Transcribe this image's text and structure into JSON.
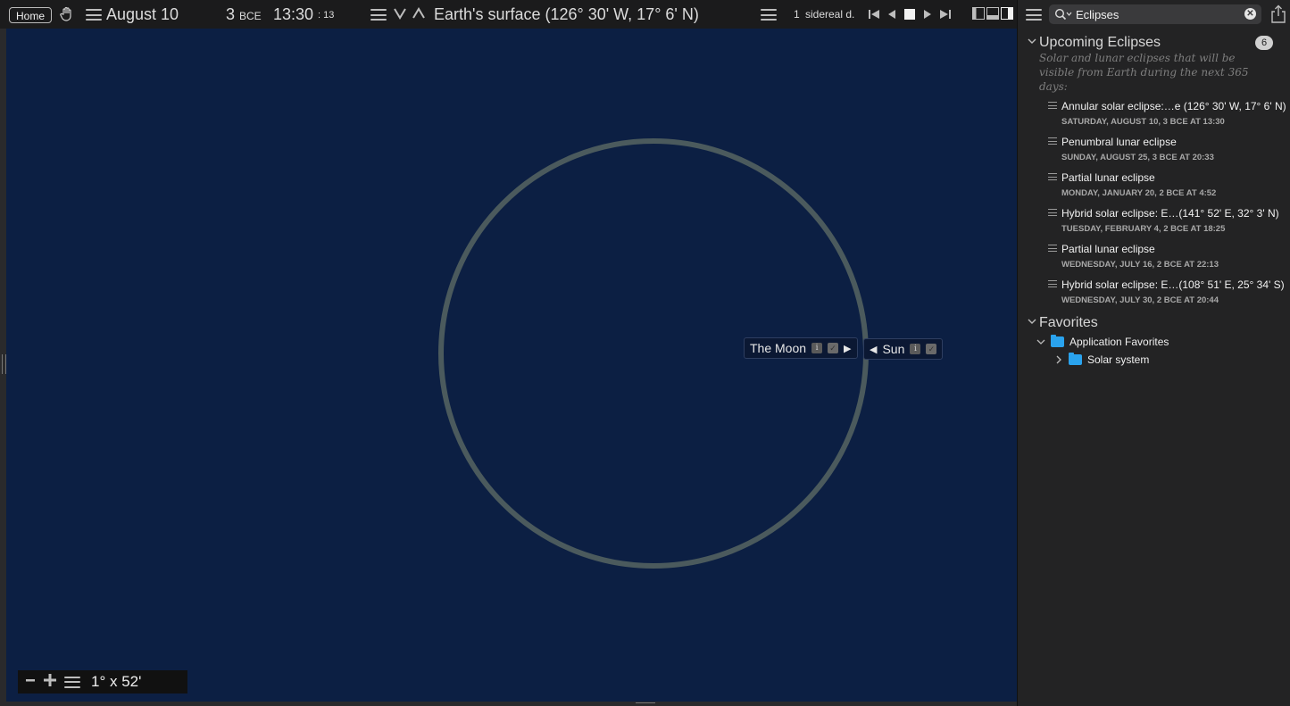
{
  "topbar": {
    "home_label": "Home",
    "date": "August 10",
    "year": "3",
    "era": "BCE",
    "time_hm": "13:30",
    "time_s": ": 13",
    "location": "Earth's surface (126° 30' W, 17° 6' N)",
    "rate_value": "1",
    "rate_unit": "sidereal d."
  },
  "sky": {
    "moon_label": "The Moon",
    "sun_label": "Sun",
    "field_of_view": "1° x 52'",
    "colors": {
      "background": "#0c1f43",
      "moon_outline": "#4b5a5d"
    }
  },
  "sidebar": {
    "search": {
      "value": "Eclipses"
    },
    "upcoming": {
      "title": "Upcoming Eclipses",
      "count": "6",
      "description": "Solar and lunar eclipses that will be visible from Earth during the next 365 days:",
      "items": [
        {
          "title": "Annular solar eclipse:…e (126° 30' W, 17° 6' N)",
          "date": "SATURDAY, AUGUST 10, 3 BCE AT 13:30"
        },
        {
          "title": "Penumbral lunar eclipse",
          "date": "SUNDAY, AUGUST 25, 3 BCE AT 20:33"
        },
        {
          "title": "Partial lunar eclipse",
          "date": "MONDAY, JANUARY 20, 2 BCE AT 4:52"
        },
        {
          "title": "Hybrid solar eclipse: E…(141° 52' E, 32° 3' N)",
          "date": "TUESDAY, FEBRUARY 4, 2 BCE AT 18:25"
        },
        {
          "title": "Partial lunar eclipse",
          "date": "WEDNESDAY, JULY 16, 2 BCE AT 22:13"
        },
        {
          "title": "Hybrid solar eclipse: E…(108° 51' E, 25° 34' S)",
          "date": "WEDNESDAY, JULY 30, 2 BCE AT 20:44"
        }
      ]
    },
    "favorites": {
      "title": "Favorites",
      "app_favorites": "Application Favorites",
      "solar_system": "Solar system"
    }
  }
}
